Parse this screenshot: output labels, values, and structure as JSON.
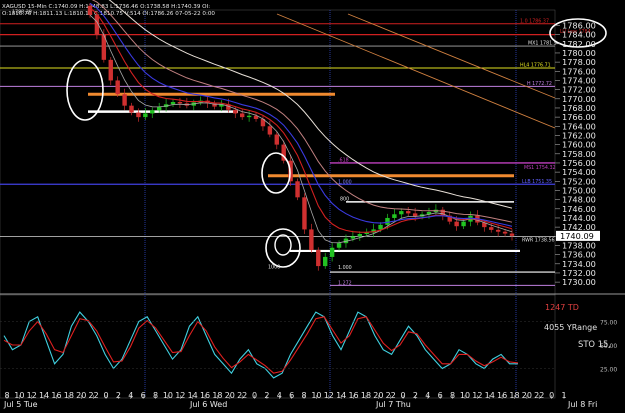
{
  "header": {
    "symbol": "XAGUSD",
    "line1": "XAGUSD 15-Min C:1740.09 H:1748.83 L:1736.46 O:1738.58 H:1740.39 OI: ",
    "line2": "O:1810.76 H:1811.13 L:1810.12 C:1810.75 V:514 OI:1786.26 07-05-22 0:00"
  },
  "colors": {
    "background": "#000000",
    "bull_candle": "#22c422",
    "bear_candle": "#d03030",
    "ema_red": "#d02020",
    "ema_blue": "#3a3ae0",
    "ema_white": "#e8e0d8",
    "ema_pink": "#c08080",
    "price_line": "#a8a8a8",
    "stoch_k": "#40d0e0",
    "stoch_d": "#e02020"
  },
  "chart_data": [
    {
      "type": "candlestick",
      "title": "XAGUSD 15-Min",
      "x_ticks": [
        "8",
        "10",
        "12",
        "14",
        "16",
        "18",
        "20",
        "22",
        "0",
        "2",
        "4",
        "6",
        "8",
        "10",
        "12",
        "14",
        "16",
        "18",
        "20",
        "22",
        "0",
        "2",
        "4",
        "6",
        "8",
        "10",
        "12",
        "14",
        "16",
        "18",
        "20",
        "22",
        "0",
        "2",
        "4",
        "6",
        "8",
        "10",
        "12",
        "14",
        "16",
        "18",
        "20",
        "22",
        "0",
        "1"
      ],
      "day_labels": [
        "Jul 5 Tue",
        "Jul 6 Wed",
        "Jul 7 Thu",
        "Jul 8 Fri"
      ],
      "y_ticks": [
        1786,
        1784,
        1782,
        1780,
        1778,
        1776,
        1774,
        1772,
        1770,
        1768,
        1766,
        1764,
        1762,
        1760,
        1758,
        1756,
        1754,
        1752,
        1750,
        1748,
        1746,
        1744,
        1742,
        1740,
        1738,
        1736,
        1734,
        1732,
        1730
      ],
      "ylim": [
        1728.5,
        1788.5
      ],
      "last_price": "1740.09",
      "price_path": [
        1788.29,
        1784.0,
        1778.5,
        1774.0,
        1771.0,
        1768.5,
        1767.0,
        1766.0,
        1766.8,
        1767.5,
        1768.2,
        1768.8,
        1769.3,
        1769.0,
        1768.5,
        1769.2,
        1769.6,
        1769.0,
        1768.3,
        1768.8,
        1767.6,
        1766.8,
        1766.0,
        1766.3,
        1765.6,
        1764.0,
        1762.2,
        1760.0,
        1756.5,
        1752.0,
        1748.5,
        1741.5,
        1737.0,
        1733.5,
        1735.5,
        1737.5,
        1738.5,
        1739.5,
        1740.0,
        1740.5,
        1740.8,
        1741.5,
        1742.5,
        1744.0,
        1744.8,
        1745.5,
        1745.0,
        1744.3,
        1744.8,
        1745.3,
        1745.8,
        1744.5,
        1743.2,
        1742.2,
        1743.2,
        1744.5,
        1743.0,
        1742.0,
        1741.4,
        1741.0,
        1740.6,
        1740.09
      ],
      "labels": [
        {
          "text": "1788.29",
          "price": 1788.29
        },
        {
          "text": "1.0 1786.37",
          "price": 1786.37
        },
        {
          "text": "LU Low 1784",
          "price": 1784.0
        },
        {
          "text": "MX1 1781.5",
          "price": 1781.5
        },
        {
          "text": "HL4 1776.71",
          "price": 1776.71
        },
        {
          "text": "H 1772.72",
          "price": 1772.72
        },
        {
          "text": "MS1 1754.32",
          "price": 1754.32
        },
        {
          "text": "LLB 1751.35",
          "price": 1751.35
        },
        {
          "text": ".618",
          "price": 1756.0
        },
        {
          "text": "1.000",
          "price": 1751.2
        },
        {
          "text": "800",
          "price": 1747.5
        },
        {
          "text": "RWR 1738.56",
          "price": 1738.56
        },
        {
          "text": "1.000",
          "price": 1732.5
        },
        {
          "text": "1.272",
          "price": 1729.2
        },
        {
          "text": "1000",
          "price": 1732.7
        }
      ]
    },
    {
      "type": "line",
      "title": "STO 15",
      "ylim": [
        0,
        100
      ],
      "y_ticks": [
        25,
        50,
        75
      ],
      "annotations": [
        "1247 TD",
        "4055 YRange",
        "STO 15,"
      ],
      "series": [
        {
          "values": [
            60,
            45,
            50,
            75,
            80,
            55,
            30,
            40,
            70,
            85,
            75,
            60,
            40,
            25,
            35,
            55,
            75,
            80,
            65,
            50,
            35,
            45,
            70,
            80,
            60,
            40,
            30,
            20,
            35,
            45,
            30,
            25,
            15,
            20,
            40,
            55,
            70,
            85,
            80,
            60,
            45,
            65,
            85,
            80,
            60,
            45,
            40,
            55,
            70,
            60,
            45,
            35,
            25,
            30,
            45,
            40,
            30,
            25,
            35,
            40,
            30,
            30
          ]
        },
        {
          "values": [
            55,
            50,
            50,
            65,
            75,
            62,
            45,
            42,
            60,
            78,
            76,
            65,
            48,
            32,
            33,
            48,
            68,
            76,
            68,
            55,
            42,
            43,
            60,
            75,
            65,
            48,
            36,
            26,
            32,
            40,
            34,
            28,
            20,
            22,
            34,
            48,
            62,
            78,
            80,
            66,
            52,
            60,
            78,
            80,
            66,
            52,
            44,
            50,
            64,
            62,
            50,
            40,
            30,
            30,
            40,
            40,
            33,
            28,
            32,
            37,
            32,
            31
          ]
        }
      ]
    }
  ]
}
